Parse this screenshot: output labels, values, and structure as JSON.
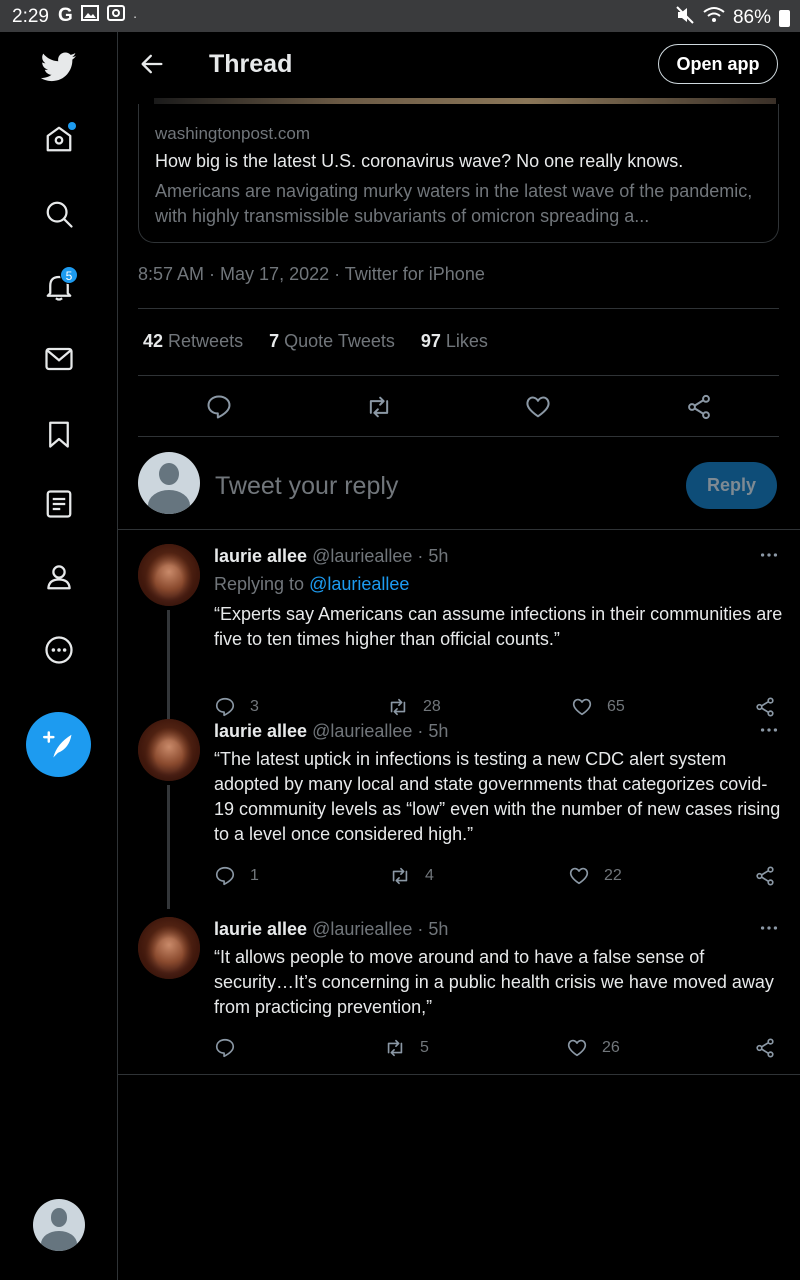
{
  "status_bar": {
    "time": "2:29",
    "g_label": "G",
    "battery": "86%"
  },
  "nav": {
    "notifications_badge": "5"
  },
  "header": {
    "title": "Thread",
    "open_app": "Open app"
  },
  "link_card": {
    "domain": "washingtonpost.com",
    "headline": "How big is the latest U.S. coronavirus wave? No one really knows.",
    "description": "Americans are navigating murky waters in the latest wave of the pandemic, with highly transmissible subvariants of omicron spreading a..."
  },
  "tweet_meta": "8:57 AM · May 17, 2022 · Twitter for iPhone",
  "stats": {
    "retweets_count": "42",
    "retweets_label": "Retweets",
    "quotes_count": "7",
    "quotes_label": "Quote Tweets",
    "likes_count": "97",
    "likes_label": "Likes"
  },
  "reply_box": {
    "placeholder": "Tweet your reply",
    "button": "Reply"
  },
  "replies": [
    {
      "name": "laurie allee",
      "handle": "@laurieallee · 5h",
      "replying_prefix": "Replying to ",
      "replying_to": "@laurieallee",
      "text": "“Experts say Americans can assume infections in their communities are five to ten times higher than official counts.”",
      "replies": "3",
      "retweets": "28",
      "likes": "65"
    },
    {
      "name": "laurie allee",
      "handle": "@laurieallee · 5h",
      "text": "“The latest uptick in infections is testing a new CDC alert system adopted by many local and state governments that categorizes covid-19 community levels as “low” even with the number of new cases rising to a level once considered high.”",
      "replies": "1",
      "retweets": "4",
      "likes": "22"
    },
    {
      "name": "laurie allee",
      "handle": "@laurieallee · 5h",
      "text": "“It allows people to move around and to have a false sense of security…It’s concerning in a public health crisis we have moved away from practicing prevention,”",
      "replies": "",
      "retweets": "5",
      "likes": "26"
    }
  ],
  "colors": {
    "accent": "#1d9bf0",
    "background": "#000000",
    "muted_text": "#71767b",
    "border": "#2f3336"
  }
}
